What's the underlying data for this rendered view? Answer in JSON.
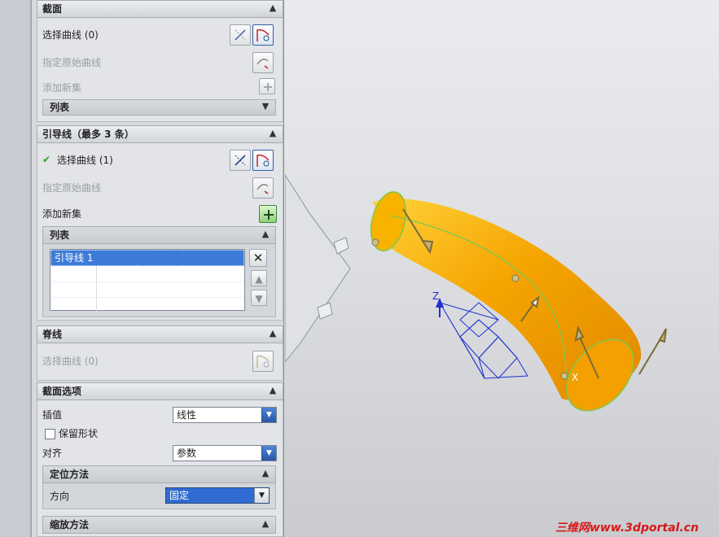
{
  "section_section": {
    "title": "截面",
    "select_curve": "选择曲线 (0)",
    "specify_original": "指定原始曲线",
    "add_new_set": "添加新集",
    "list_label": "列表"
  },
  "guide_section": {
    "title": "引导线（最多 3 条）",
    "select_curve": "选择曲线 (1)",
    "specify_original": "指定原始曲线",
    "add_new_set": "添加新集",
    "list_label": "列表",
    "list_rows": [
      "引导线 1",
      "",
      "",
      ""
    ]
  },
  "spine_section": {
    "title": "脊线",
    "select_curve": "选择曲线 (0)"
  },
  "section_options": {
    "title": "截面选项",
    "interpolation_label": "插值",
    "interpolation_value": "线性",
    "keep_shape_label": "保留形状",
    "align_label": "对齐",
    "align_value": "参数",
    "orient_method_title": "定位方法",
    "direction_label": "方向",
    "direction_value": "固定",
    "scale_method_title": "缩放方法"
  },
  "viewport": {
    "axis_z": "Z",
    "axis_x": "X",
    "tube_color": "#f5a400",
    "curve_color": "#7ec850",
    "triad_color": "#1f2fd0"
  },
  "watermark": "三维网www.3dportal.cn"
}
